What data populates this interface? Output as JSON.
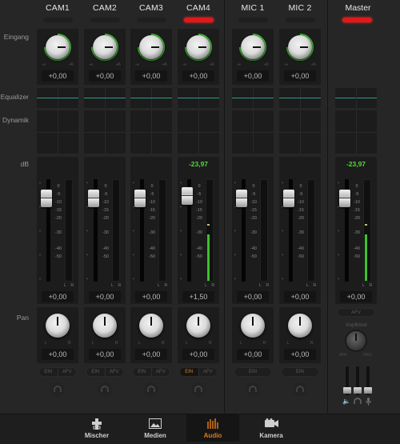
{
  "row_labels": {
    "input": "Eingang",
    "equalizer": "Equalizer",
    "dynamics": "Dynamik",
    "db": "dB",
    "pan": "Pan"
  },
  "gain_scale": {
    "min": "-∞",
    "max": "+6"
  },
  "pan_scale": {
    "left": "L",
    "right": "R"
  },
  "fader_scale": [
    "0",
    "-5",
    "-10",
    "-15",
    "-20",
    "-30",
    "-40",
    "-50"
  ],
  "meter_channel_labels": "L R",
  "channels": [
    {
      "name": "CAM1",
      "tally_live": false,
      "gain": "+0,00",
      "peak": "",
      "fader": "+0,00",
      "fader_db": -7,
      "meter_level_db": null,
      "pan": "+0,00",
      "buttons": [
        "EIN",
        "AFV"
      ],
      "ein_on": false
    },
    {
      "name": "CAM2",
      "tally_live": false,
      "gain": "+0,00",
      "peak": "",
      "fader": "+0,00",
      "fader_db": -7,
      "meter_level_db": null,
      "pan": "+0,00",
      "buttons": [
        "EIN",
        "AFV"
      ],
      "ein_on": false
    },
    {
      "name": "CAM3",
      "tally_live": false,
      "gain": "+0,00",
      "peak": "",
      "fader": "+0,00",
      "fader_db": -7,
      "meter_level_db": null,
      "pan": "+0,00",
      "buttons": [
        "EIN",
        "AFV"
      ],
      "ein_on": false
    },
    {
      "name": "CAM4",
      "tally_live": true,
      "gain": "+0,00",
      "peak": "-23,97",
      "fader": "+1,50",
      "fader_db": -5.5,
      "meter_level_db": -30,
      "meter_peak_db": -24,
      "pan": "+0,00",
      "buttons": [
        "EIN",
        "AFV"
      ],
      "ein_on": true
    },
    {
      "name": "MIC 1",
      "tally_live": false,
      "gain": "+0,00",
      "peak": "",
      "fader": "+0,00",
      "fader_db": -7,
      "meter_level_db": null,
      "pan": "+0,00",
      "buttons": [
        "EIN"
      ],
      "ein_on": false
    },
    {
      "name": "MIC 2",
      "tally_live": false,
      "gain": "+0,00",
      "peak": "",
      "fader": "+0,00",
      "fader_db": -7,
      "meter_level_db": null,
      "pan": "+0,00",
      "buttons": [
        "EIN"
      ],
      "ein_on": false
    }
  ],
  "master": {
    "name": "Master",
    "tally_live": true,
    "peak": "-23,97",
    "fader": "+0,00",
    "fader_db": -7,
    "meter_level_db": -30,
    "meter_peak_db": -24,
    "afv_label": "AFV",
    "phones_label": "Kopfhörer",
    "phones_min": "MIN",
    "phones_max": "MAX",
    "mini_icons": [
      "speaker-icon",
      "headphones-icon",
      "microphone-icon"
    ]
  },
  "nav": {
    "items": [
      {
        "label": "Mischer",
        "icon": "mixer-icon",
        "active": false
      },
      {
        "label": "Medien",
        "icon": "media-icon",
        "active": false
      },
      {
        "label": "Audio",
        "icon": "audio-icon",
        "active": true
      },
      {
        "label": "Kamera",
        "icon": "camera-icon",
        "active": false
      }
    ]
  },
  "colors": {
    "accent": "#e07a1a",
    "tally_red": "#e01818",
    "meter_green": "#3ec22c",
    "eq_line": "#2a9b8a",
    "peak_text": "#55d63a"
  }
}
